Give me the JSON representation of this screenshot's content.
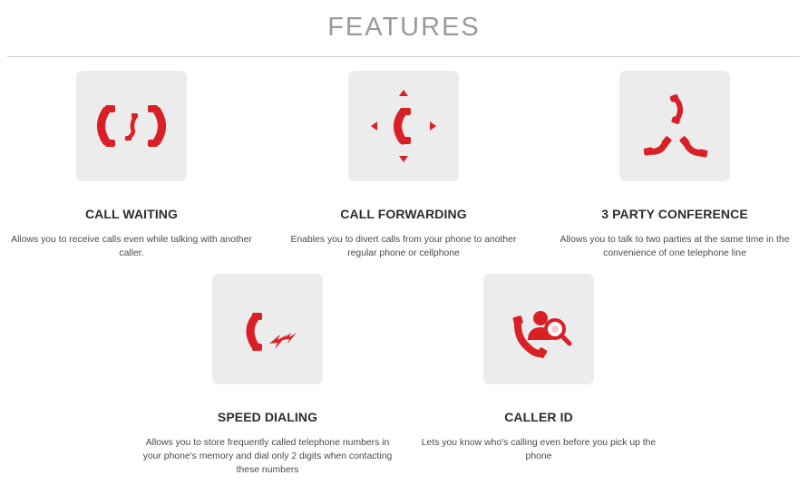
{
  "page": {
    "title": "FEATURES"
  },
  "colors": {
    "accent": "#d92027",
    "icon_bg": "#ececec",
    "title": "#9a9a9a"
  },
  "features": [
    {
      "icon": "call-waiting-icon",
      "title": "CALL WAITING",
      "description": "Allows you to receive calls even while talking with another caller."
    },
    {
      "icon": "call-forwarding-icon",
      "title": "CALL FORWARDING",
      "description": "Enables you to divert calls from your phone to another regular phone or cellphone"
    },
    {
      "icon": "conference-call-icon",
      "title": "3 PARTY CONFERENCE",
      "description": "Allows you to talk to two parties at the same time in the convenience of one telephone line"
    },
    {
      "icon": "speed-dial-icon",
      "title": "SPEED DIALING",
      "description": "Allows you to store frequently called telephone numbers in your phone's memory and dial only 2 digits when contacting these numbers"
    },
    {
      "icon": "caller-id-icon",
      "title": "CALLER ID",
      "description": "Lets you know who's calling even before you pick up the phone"
    }
  ]
}
